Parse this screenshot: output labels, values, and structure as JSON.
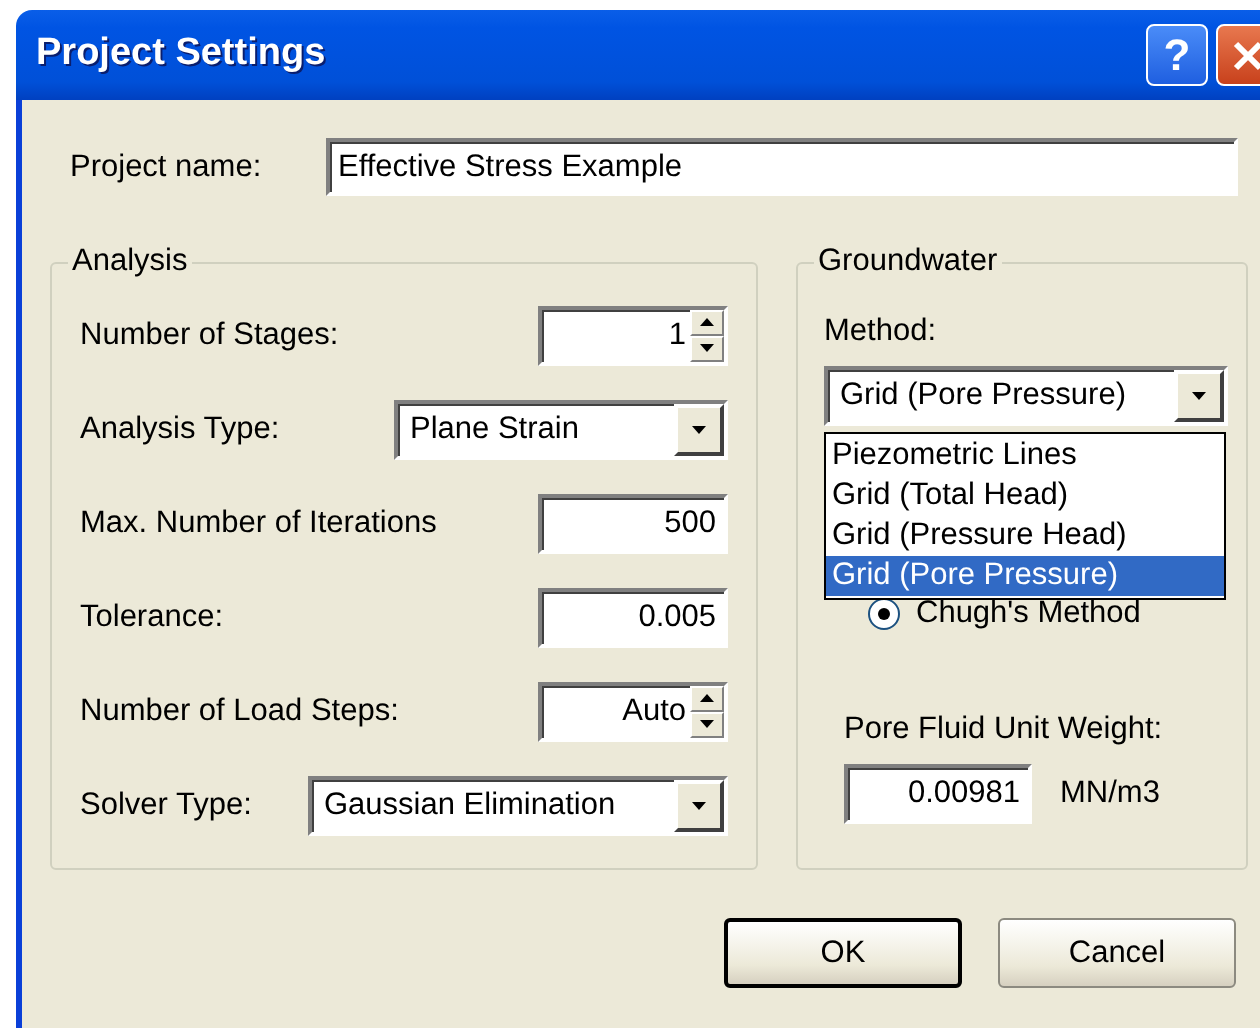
{
  "window": {
    "title": "Project Settings",
    "help_label": "?"
  },
  "project_name": {
    "label": "Project name:",
    "value": "Effective Stress Example"
  },
  "analysis": {
    "title": "Analysis",
    "rows": [
      {
        "kind": "spinner",
        "label": "Number of Stages:",
        "value": "1"
      },
      {
        "kind": "combo",
        "label": "Analysis Type:",
        "value": "Plane Strain"
      },
      {
        "kind": "text",
        "label": "Max. Number of Iterations",
        "value": "500"
      },
      {
        "kind": "text",
        "label": "Tolerance:",
        "value": "0.005"
      },
      {
        "kind": "spinner",
        "label": "Number of Load Steps:",
        "value": "Auto"
      },
      {
        "kind": "combo",
        "label": "Solver Type:",
        "value": "Gaussian Elimination"
      }
    ]
  },
  "groundwater": {
    "title": "Groundwater",
    "method_label": "Method:",
    "method_value": "Grid (Pore Pressure)",
    "expanded": true,
    "options": [
      {
        "label": "Piezometric Lines",
        "selected": false
      },
      {
        "label": "Grid (Total Head)",
        "selected": false
      },
      {
        "label": "Grid (Pressure Head)",
        "selected": false
      },
      {
        "label": "Grid (Pore Pressure)",
        "selected": true
      }
    ],
    "radio": {
      "label": "Chugh's Method",
      "checked": true
    },
    "unit_weight": {
      "label": "Pore Fluid Unit Weight:",
      "value": "0.00981",
      "unit": "MN/m3"
    }
  },
  "buttons": [
    {
      "label": "OK",
      "default": true
    },
    {
      "label": "Cancel",
      "default": false
    }
  ]
}
